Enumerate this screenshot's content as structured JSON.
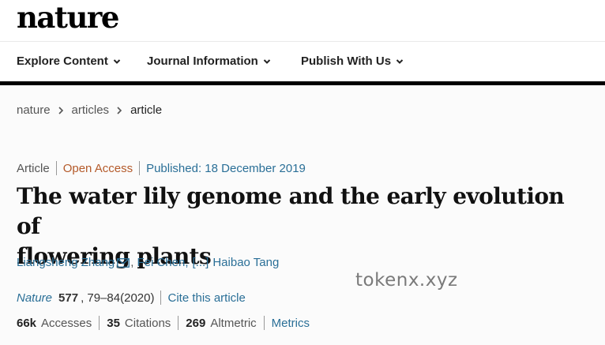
{
  "site": {
    "logo": "nature"
  },
  "nav": {
    "items": [
      {
        "label": "Explore Content"
      },
      {
        "label": "Journal Information"
      },
      {
        "label": "Publish With Us"
      }
    ]
  },
  "breadcrumb": {
    "items": [
      "nature",
      "articles",
      "article"
    ]
  },
  "article": {
    "type": "Article",
    "access": "Open Access",
    "published": "Published: 18 December 2019",
    "title_line1": "The water lily genome and the early evolution of",
    "title_line2": "flowering plants",
    "authors": {
      "first": "Liangsheng Zhang",
      "second": "Fei Chen,",
      "ellipsis": "[...]",
      "last": "Haibao Tang"
    },
    "citation": {
      "journal": "Nature",
      "volume": "577",
      "pages": "79–84(2020)",
      "cite_link": "Cite this article"
    },
    "metrics": {
      "accesses_count": "66k",
      "accesses_label": "Accesses",
      "citations_count": "35",
      "citations_label": "Citations",
      "altmetric_count": "269",
      "altmetric_label": "Altmetric",
      "metrics_link": "Metrics"
    }
  },
  "watermark": "tokenx.xyz",
  "colors": {
    "link": "#2a6f97",
    "open_access": "#b45a2a",
    "rule": "#000000"
  }
}
